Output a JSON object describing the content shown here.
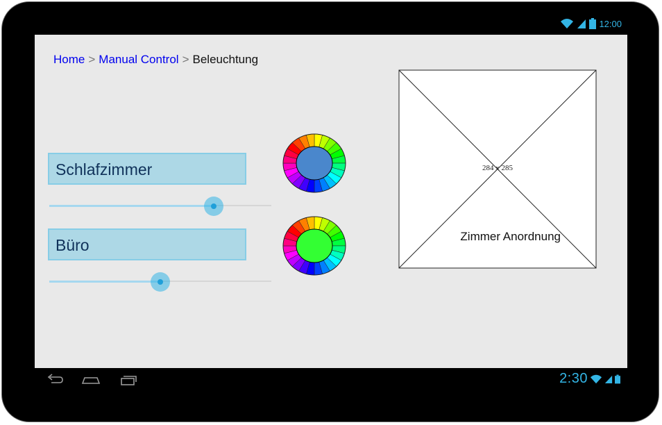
{
  "status_bar": {
    "time": "12:00"
  },
  "breadcrumb": {
    "home": "Home",
    "separator": ">",
    "manual_control": "Manual Control",
    "current": "Beleuchtung"
  },
  "rooms": [
    {
      "label": "Schlafzimmer",
      "brightness": 0.74,
      "color": "#4a87cc"
    },
    {
      "label": "Büro",
      "brightness": 0.5,
      "color": "#33ff33"
    }
  ],
  "image_placeholder": {
    "size_label": "284 x 285",
    "caption": "Zimmer Anordnung"
  },
  "nav_bar": {
    "time": "2:30"
  },
  "colors": {
    "accent": "#33b5e5",
    "room_box": "#add8e6",
    "link": "#0000ee"
  }
}
